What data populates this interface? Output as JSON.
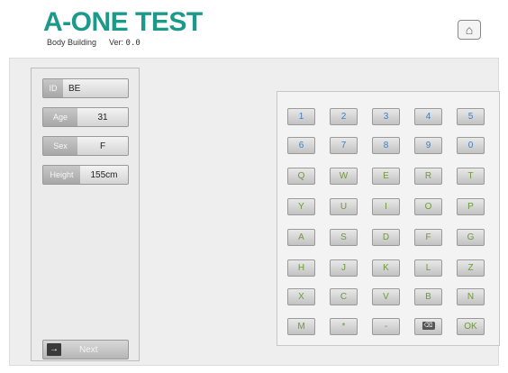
{
  "header": {
    "title": "A-ONE TEST",
    "subtitle": "Body Building",
    "version_label": "Ver:",
    "version_value": "0.0",
    "home_icon": "home-icon"
  },
  "form": {
    "fields": [
      {
        "label": "ID",
        "value": "BE"
      },
      {
        "label": "Age",
        "value": "31"
      },
      {
        "label": "Sex",
        "value": "F"
      },
      {
        "label": "Height",
        "value": "155cm"
      }
    ],
    "next_label": "Next",
    "next_icon": "arrow-right-icon"
  },
  "keypad": {
    "rows": [
      [
        "1",
        "2",
        "3",
        "4",
        "5"
      ],
      [
        "6",
        "7",
        "8",
        "9",
        "0"
      ],
      [
        "Q",
        "W",
        "E",
        "R",
        "T"
      ],
      [
        "Y",
        "U",
        "I",
        "O",
        "P"
      ],
      [
        "A",
        "S",
        "D",
        "F",
        "G"
      ],
      [
        "H",
        "J",
        "K",
        "L",
        "Z"
      ],
      [
        "X",
        "C",
        "V",
        "B",
        "N"
      ],
      [
        "M",
        "*",
        "-",
        "⌫",
        "OK"
      ]
    ]
  },
  "colors": {
    "brand": "#1b9a8a",
    "number_key": "#3c7fc4",
    "letter_key": "#6e9a38"
  }
}
